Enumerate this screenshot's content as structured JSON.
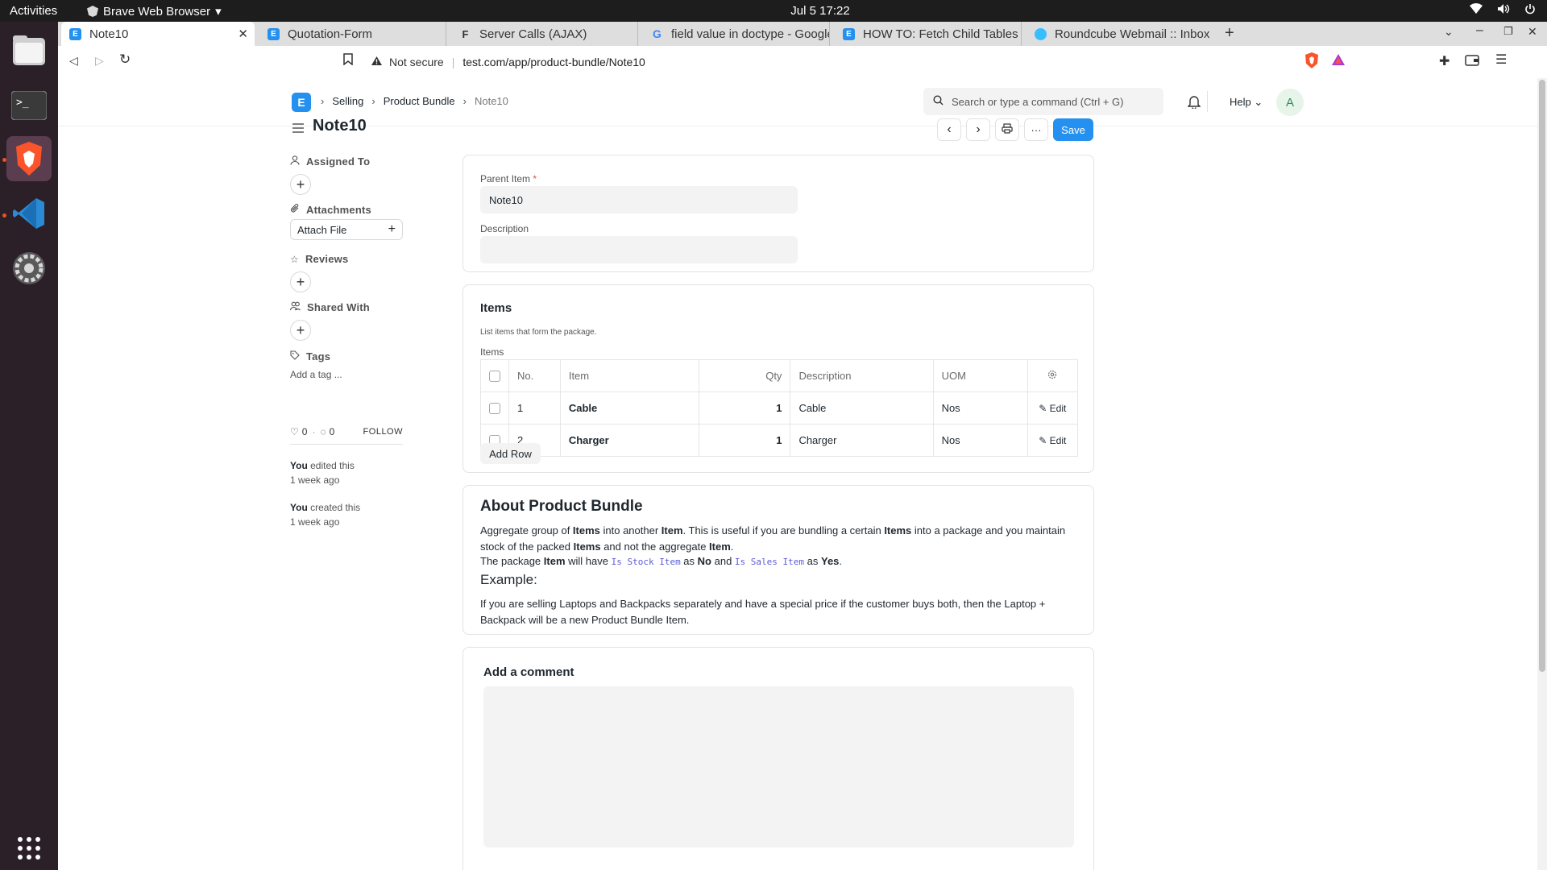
{
  "os": {
    "activities": "Activities",
    "app_menu": "Brave Web Browser",
    "clock": "Jul 5  17:22"
  },
  "browser": {
    "tabs": [
      {
        "title": "Note10",
        "active": true
      },
      {
        "title": "Quotation-Form"
      },
      {
        "title": "Server Calls (AJAX)"
      },
      {
        "title": "field value in doctype - Google"
      },
      {
        "title": "HOW TO: Fetch Child Tables -"
      },
      {
        "title": "Roundcube Webmail :: Inbox"
      }
    ],
    "security": "Not secure",
    "url": "test.com/app/product-bundle/Note10"
  },
  "app": {
    "logo_letter": "E",
    "breadcrumbs": [
      "Selling",
      "Product Bundle",
      "Note10"
    ],
    "search_placeholder": "Search or type a command (Ctrl + G)",
    "help": "Help",
    "avatar": "A"
  },
  "doc": {
    "title": "Note10",
    "save_label": "Save"
  },
  "sidebar": {
    "assigned_to": "Assigned To",
    "attachments": "Attachments",
    "attach_file": "Attach File",
    "reviews": "Reviews",
    "shared_with": "Shared With",
    "tags": "Tags",
    "add_tag": "Add a tag ...",
    "likes": "0",
    "comments": "0",
    "follow": "FOLLOW",
    "activity": [
      {
        "who": "You",
        "what": " edited this",
        "when": "1 week ago"
      },
      {
        "who": "You",
        "what": " created this",
        "when": "1 week ago"
      }
    ]
  },
  "form": {
    "parent_item_label": "Parent Item",
    "required_mark": "*",
    "parent_item_value": "Note10",
    "description_label": "Description",
    "description_value": ""
  },
  "items_section": {
    "title": "Items",
    "help": "List items that form the package.",
    "table_label": "Items",
    "columns": {
      "no": "No.",
      "item": "Item",
      "qty": "Qty",
      "description": "Description",
      "uom": "UOM"
    },
    "rows": [
      {
        "no": "1",
        "item": "Cable",
        "qty": "1",
        "description": "Cable",
        "uom": "Nos",
        "edit": "Edit"
      },
      {
        "no": "2",
        "item": "Charger",
        "qty": "1",
        "description": "Charger",
        "uom": "Nos",
        "edit": "Edit"
      }
    ],
    "add_row": "Add Row"
  },
  "about": {
    "title": "About Product Bundle",
    "p1": {
      "a": "Aggregate group of ",
      "b": "Items",
      "c": " into another ",
      "d": "Item",
      "e": ". This is useful if you are bundling a certain ",
      "f": "Items",
      "g": " into a package and you maintain stock of the packed ",
      "h": "Items",
      "i": " and not the aggregate ",
      "j": "Item",
      "k": "."
    },
    "p2": {
      "a": "The package ",
      "b": "Item",
      "c": " will have ",
      "d": "Is Stock Item",
      "e": " as ",
      "f": "No",
      "g": " and ",
      "h": "Is Sales Item",
      "i": " as ",
      "j": "Yes",
      "k": "."
    },
    "example_title": "Example:",
    "example": "If you are selling Laptops and Backpacks separately and have a special price if the customer buys both, then the Laptop + Backpack will be a new Product Bundle Item."
  },
  "comment": {
    "title": "Add a comment"
  }
}
